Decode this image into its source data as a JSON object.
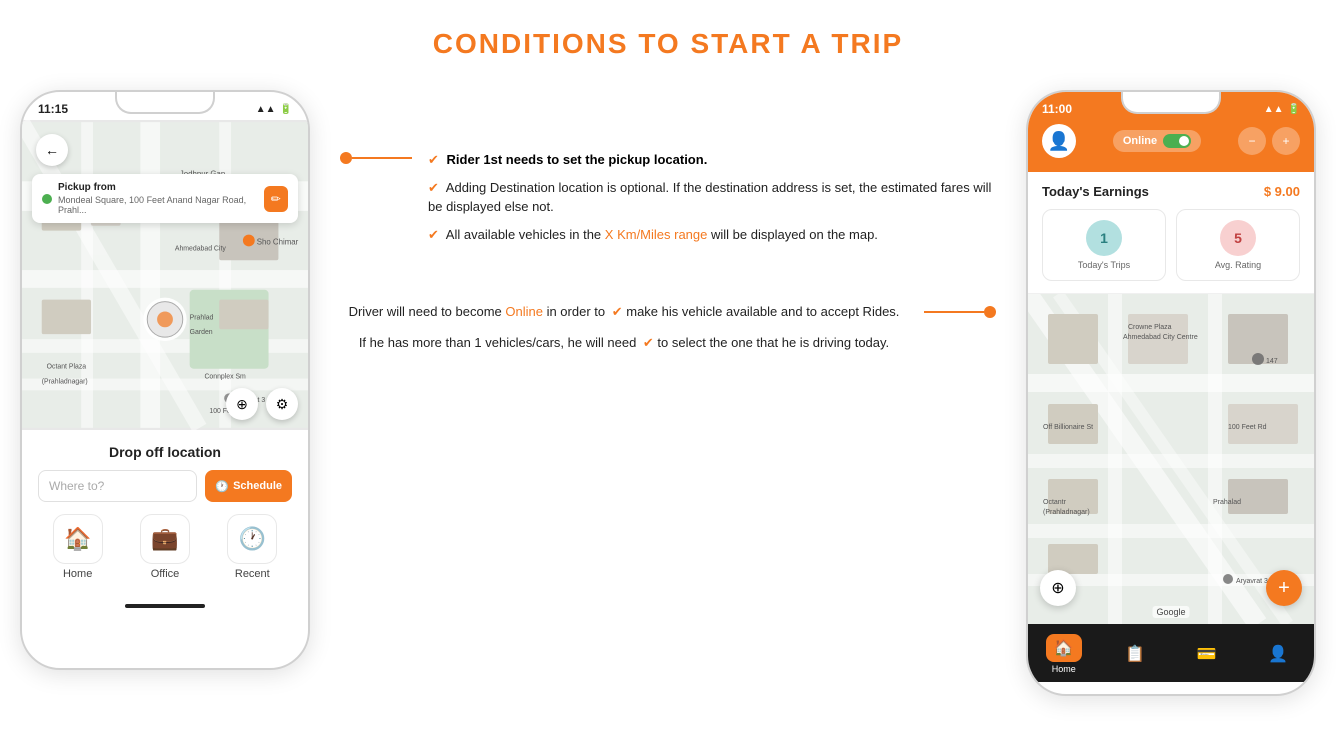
{
  "page": {
    "title": "CONDITIONS TO START A TRIP"
  },
  "left_phone": {
    "time": "11:15",
    "pickup_label": "Pickup from",
    "pickup_address": "Mondeal Square, 100 Feet Anand Nagar Road, Prahl...",
    "dropoff_title": "Drop off location",
    "where_to_placeholder": "Where to?",
    "schedule_btn": "Schedule",
    "shortcuts": [
      {
        "label": "Home",
        "icon": "🏠",
        "type": "home"
      },
      {
        "label": "Office",
        "icon": "💼",
        "type": "office"
      },
      {
        "label": "Recent",
        "icon": "🕐",
        "type": "recent"
      }
    ]
  },
  "right_phone": {
    "time": "11:00",
    "online_status": "Online",
    "earnings_title": "Today's Earnings",
    "earnings_amount": "$ 9.00",
    "trips_count": "1",
    "trips_label": "Today's Trips",
    "rating": "5",
    "rating_label": "Avg. Rating"
  },
  "annotations": {
    "top": [
      {
        "text": "Rider 1st needs to set the pickup location.",
        "bold": true
      },
      {
        "text": "Adding Destination location is optional. If the destination address is set, the estimated fares will be displayed else not.",
        "bold": false
      },
      {
        "text": "All available vehicles in the X Km/Miles range will be displayed on the map.",
        "highlight": "X Km/Miles range"
      }
    ],
    "bottom": [
      {
        "text": "Driver will need to become Online in order to make his vehicle available and to accept Rides.",
        "highlight": "Online"
      },
      {
        "text": "If he has more than 1 vehicles/cars, he will need to select the one that he is driving today."
      }
    ]
  }
}
